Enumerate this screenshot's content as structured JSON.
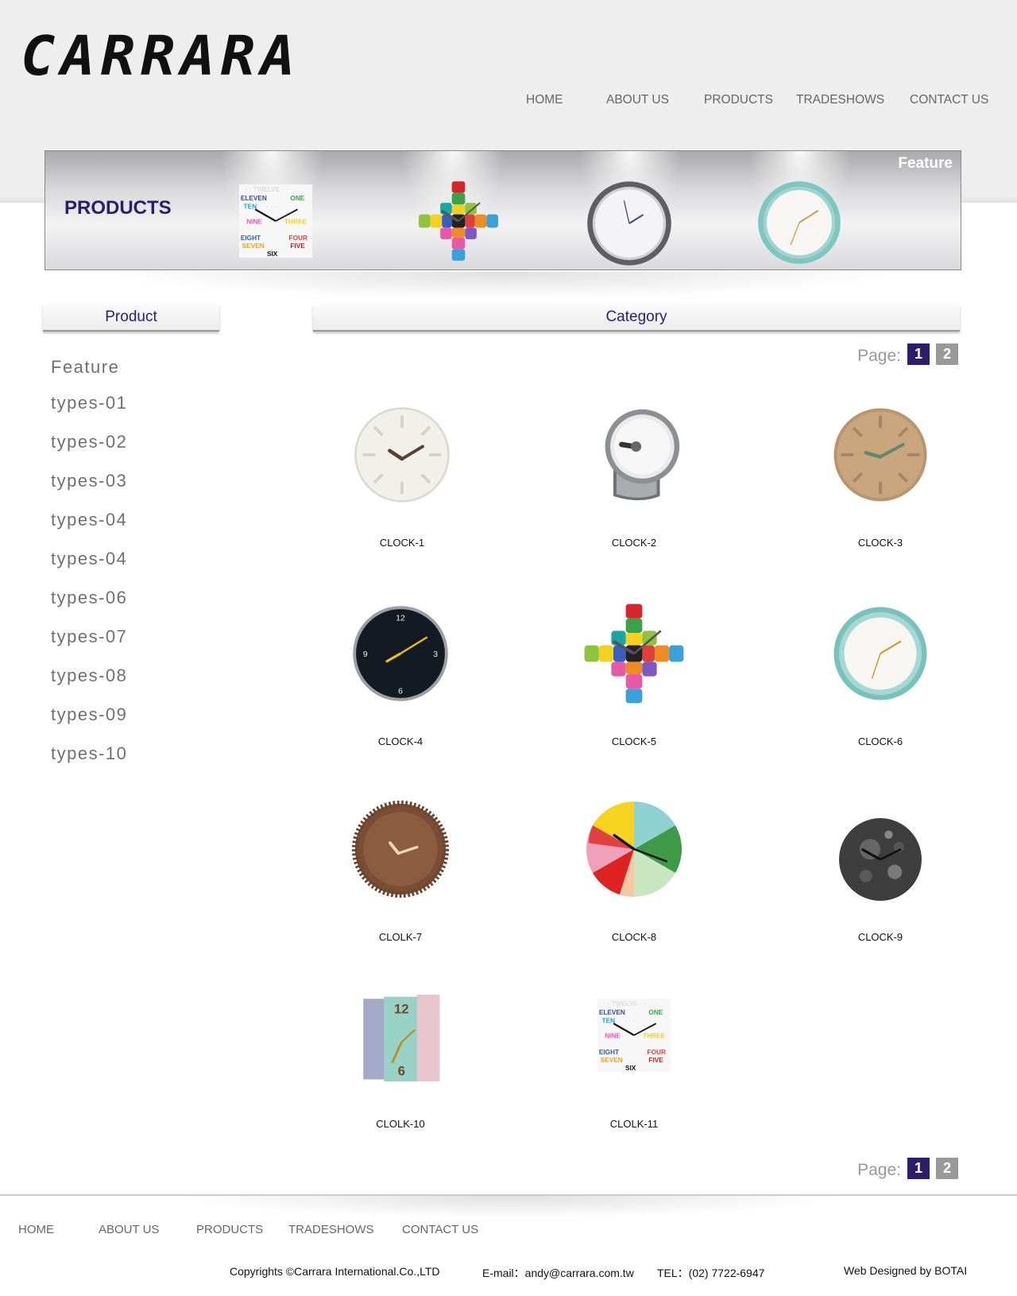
{
  "brand": {
    "logo_text": "CARRARA"
  },
  "nav": [
    {
      "label": "HOME"
    },
    {
      "label": "ABOUT US"
    },
    {
      "label": "PRODUCTS"
    },
    {
      "label": "TRADESHOWS"
    },
    {
      "label": "CONTACT US"
    }
  ],
  "banner": {
    "title": "PRODUCTS",
    "feature_label": "Feature"
  },
  "sidebar": {
    "header": "Product",
    "items": [
      {
        "label": "Feature"
      },
      {
        "label": "types-01"
      },
      {
        "label": "types-02"
      },
      {
        "label": "types-03"
      },
      {
        "label": "types-04"
      },
      {
        "label": "types-04"
      },
      {
        "label": "types-06"
      },
      {
        "label": "types-07"
      },
      {
        "label": "types-08"
      },
      {
        "label": "types-09"
      },
      {
        "label": "types-10"
      }
    ]
  },
  "category": {
    "header": "Category"
  },
  "pager": {
    "label": "Page:",
    "pages": [
      "1",
      "2"
    ],
    "current": "1"
  },
  "products": [
    {
      "name": "CLOCK-1",
      "icon": "white-ridged-clock-icon"
    },
    {
      "name": "CLOCK-2",
      "icon": "silver-desk-clock-icon"
    },
    {
      "name": "CLOCK-3",
      "icon": "tan-ridged-clock-icon"
    },
    {
      "name": "CLOCK-4",
      "icon": "black-wall-clock-icon"
    },
    {
      "name": "CLOCK-5",
      "icon": "puzzle-clock-icon"
    },
    {
      "name": "CLOCK-6",
      "icon": "mint-wall-clock-icon"
    },
    {
      "name": "CLOLK-7",
      "icon": "wood-spiky-clock-icon"
    },
    {
      "name": "CLOCK-8",
      "icon": "color-wheel-clock-icon"
    },
    {
      "name": "CLOCK-9",
      "icon": "moon-clock-icon"
    },
    {
      "name": "CLOLK-10",
      "icon": "book-clock-icon"
    },
    {
      "name": "CLOLK-11",
      "icon": "word-clock-icon"
    }
  ],
  "colors": {
    "accent": "#2c1e6b",
    "page_inactive": "#9a9a9a",
    "nav_text": "#666666"
  },
  "footer": {
    "nav": [
      {
        "label": "HOME"
      },
      {
        "label": "ABOUT US"
      },
      {
        "label": "PRODUCTS"
      },
      {
        "label": "TRADESHOWS"
      },
      {
        "label": "CONTACT US"
      }
    ],
    "copyright": "Copyrights ©Carrara International.Co.,LTD",
    "email": "E-mail：andy@carrara.com.tw",
    "tel": "TEL：(02) 7722-6947",
    "credit": "Web Designed by BOTAI"
  }
}
